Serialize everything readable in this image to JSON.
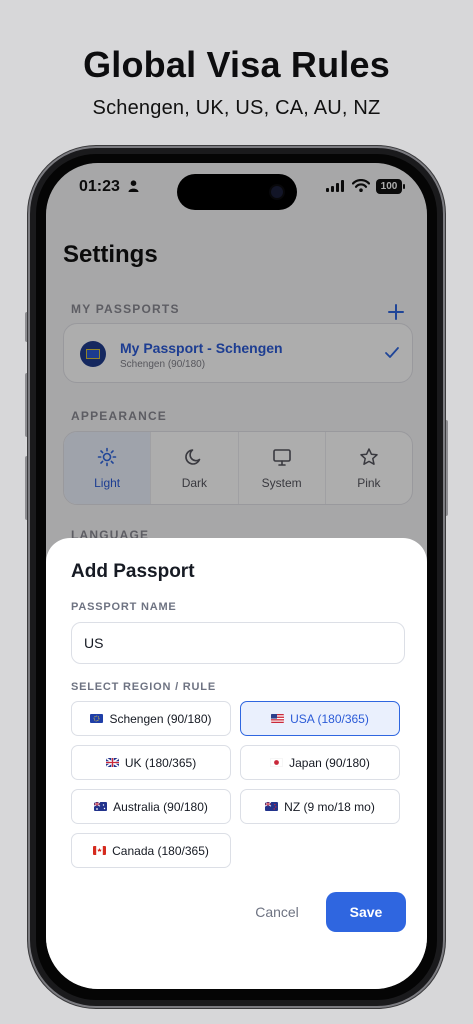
{
  "hero": {
    "title": "Global Visa Rules",
    "subtitle": "Schengen, UK, US, CA, AU, NZ"
  },
  "status": {
    "time": "01:23",
    "battery": "100"
  },
  "settings": {
    "title": "Settings",
    "passports_label": "MY PASSPORTS",
    "passport": {
      "name": "My Passport - Schengen",
      "rule": "Schengen (90/180)"
    },
    "appearance_label": "APPEARANCE",
    "appearance_options": [
      {
        "label": "Light",
        "icon": "sun-icon",
        "selected": true
      },
      {
        "label": "Dark",
        "icon": "moon-icon",
        "selected": false
      },
      {
        "label": "System",
        "icon": "monitor-icon",
        "selected": false
      },
      {
        "label": "Pink",
        "icon": "star-icon",
        "selected": false
      }
    ],
    "language_label": "LANGUAGE"
  },
  "sheet": {
    "title": "Add Passport",
    "name_label": "PASSPORT NAME",
    "name_value": "US",
    "region_label": "SELECT REGION / RULE",
    "regions": [
      {
        "label": "Schengen (90/180)",
        "flag": "eu-flag",
        "selected": false
      },
      {
        "label": "USA (180/365)",
        "flag": "us-flag",
        "selected": true
      },
      {
        "label": "UK (180/365)",
        "flag": "uk-flag",
        "selected": false
      },
      {
        "label": "Japan (90/180)",
        "flag": "japan-flag",
        "selected": false
      },
      {
        "label": "Australia (90/180)",
        "flag": "australia-flag",
        "selected": false
      },
      {
        "label": "NZ (9 mo/18 mo)",
        "flag": "nz-flag",
        "selected": false
      },
      {
        "label": "Canada (180/365)",
        "flag": "canada-flag",
        "selected": false
      }
    ],
    "cancel_label": "Cancel",
    "save_label": "Save"
  },
  "colors": {
    "accent": "#2f66e0",
    "selected_bg": "#eaf0fd"
  }
}
